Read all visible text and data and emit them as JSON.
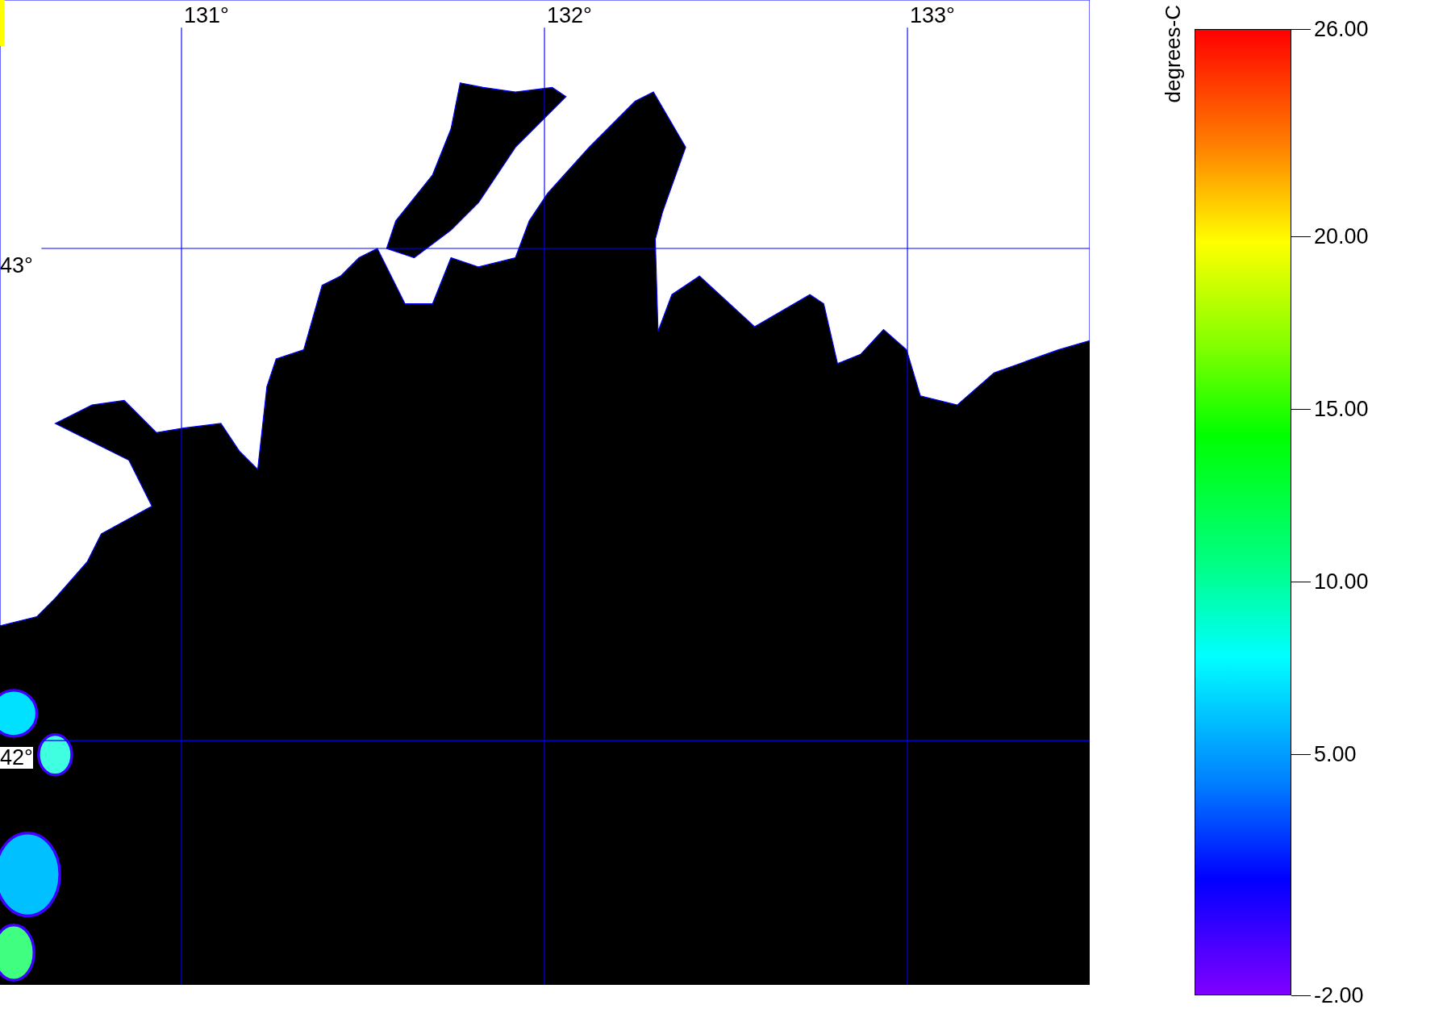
{
  "map": {
    "lon_labels": [
      "131°",
      "132°",
      "133°"
    ],
    "lat_labels": [
      "43°",
      "42°"
    ]
  },
  "colorbar": {
    "unit": "degrees-C",
    "ticks": [
      {
        "label": "26.00"
      },
      {
        "label": "20.00"
      },
      {
        "label": "15.00"
      },
      {
        "label": "10.00"
      },
      {
        "label": "5.00"
      },
      {
        "label": "-2.00"
      }
    ]
  }
}
